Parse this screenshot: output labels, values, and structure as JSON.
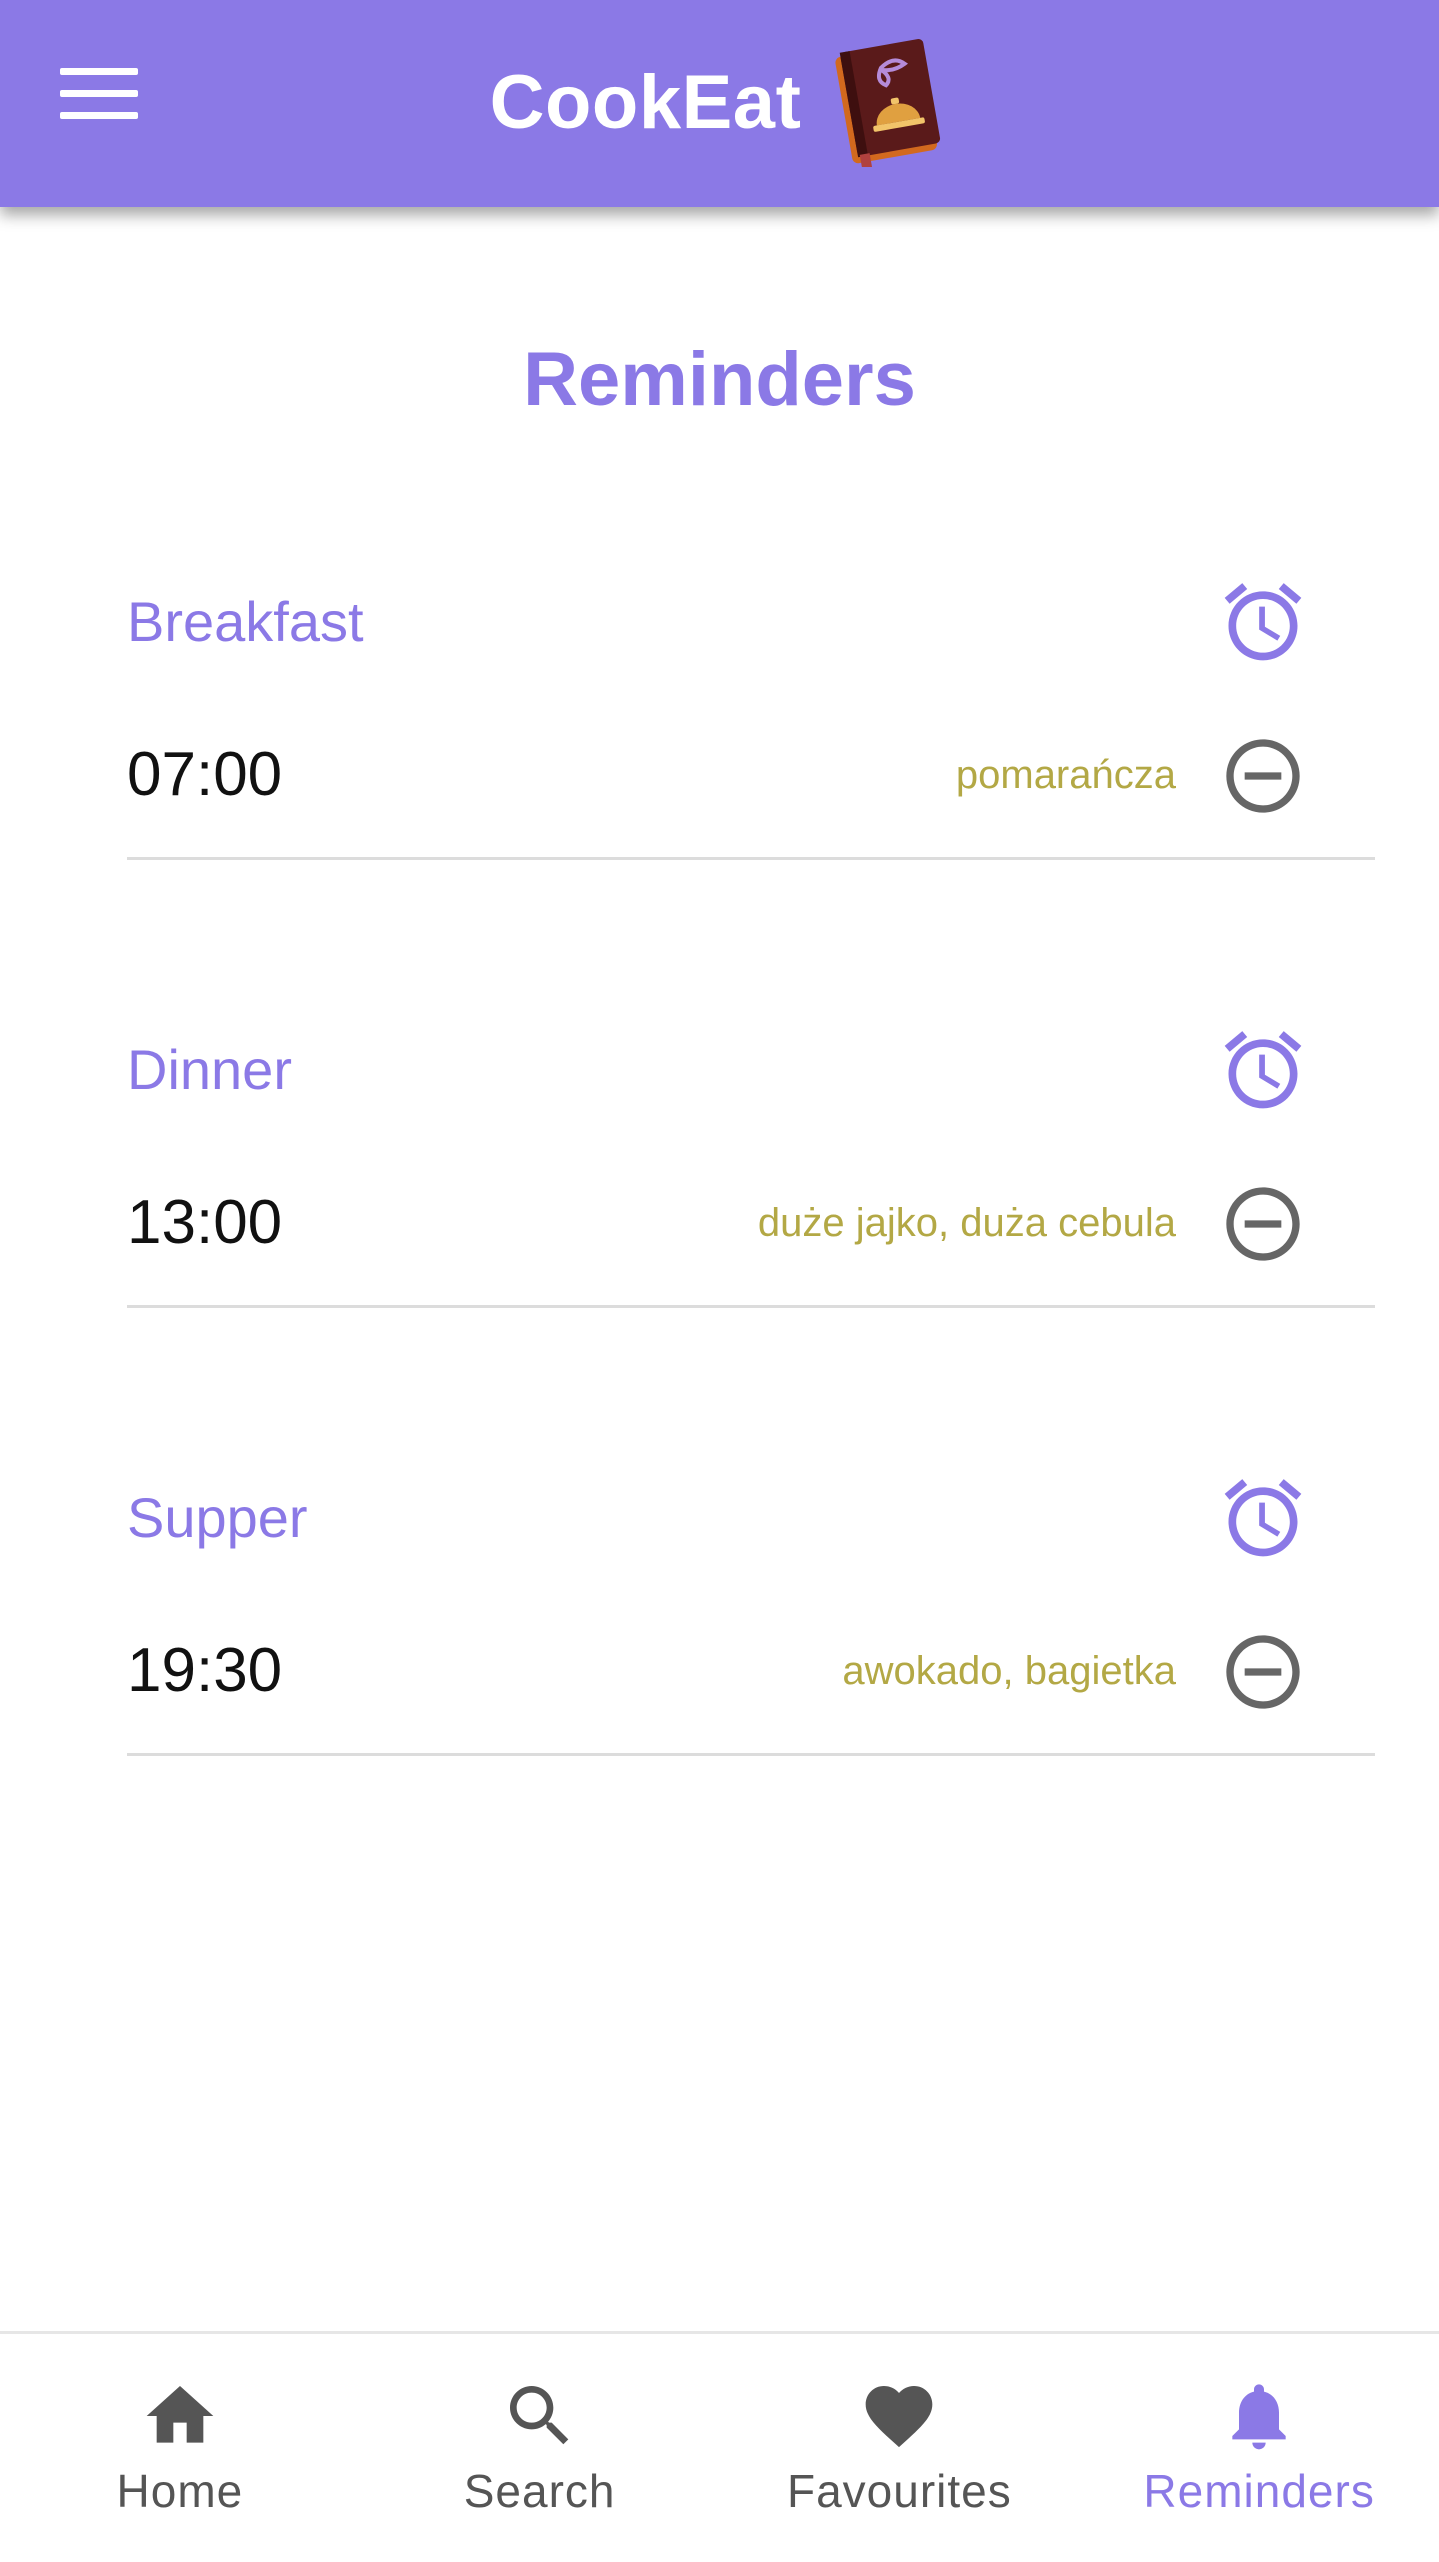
{
  "app": {
    "title": "CookEat",
    "colors": {
      "primary": "#8B79E6",
      "accent_text": "#B3A845",
      "icon_gray": "#666666"
    }
  },
  "header": {
    "menu_icon": "hamburger-menu-icon",
    "logo_icon": "recipe-book-icon"
  },
  "page": {
    "title": "Reminders"
  },
  "reminders": [
    {
      "meal": "Breakfast",
      "time": "07:00",
      "products": "pomarańcza",
      "alarm_icon": "alarm-clock-icon",
      "remove_icon": "remove-circle-icon"
    },
    {
      "meal": "Dinner",
      "time": "13:00",
      "products": "duże jajko, duża cebula",
      "alarm_icon": "alarm-clock-icon",
      "remove_icon": "remove-circle-icon"
    },
    {
      "meal": "Supper",
      "time": "19:30",
      "products": "awokado, bagietka",
      "alarm_icon": "alarm-clock-icon",
      "remove_icon": "remove-circle-icon"
    }
  ],
  "bottom_nav": {
    "active": "Reminders",
    "items": [
      {
        "label": "Home",
        "icon": "home-icon"
      },
      {
        "label": "Search",
        "icon": "search-icon"
      },
      {
        "label": "Favourites",
        "icon": "heart-icon"
      },
      {
        "label": "Reminders",
        "icon": "bell-icon"
      }
    ]
  }
}
